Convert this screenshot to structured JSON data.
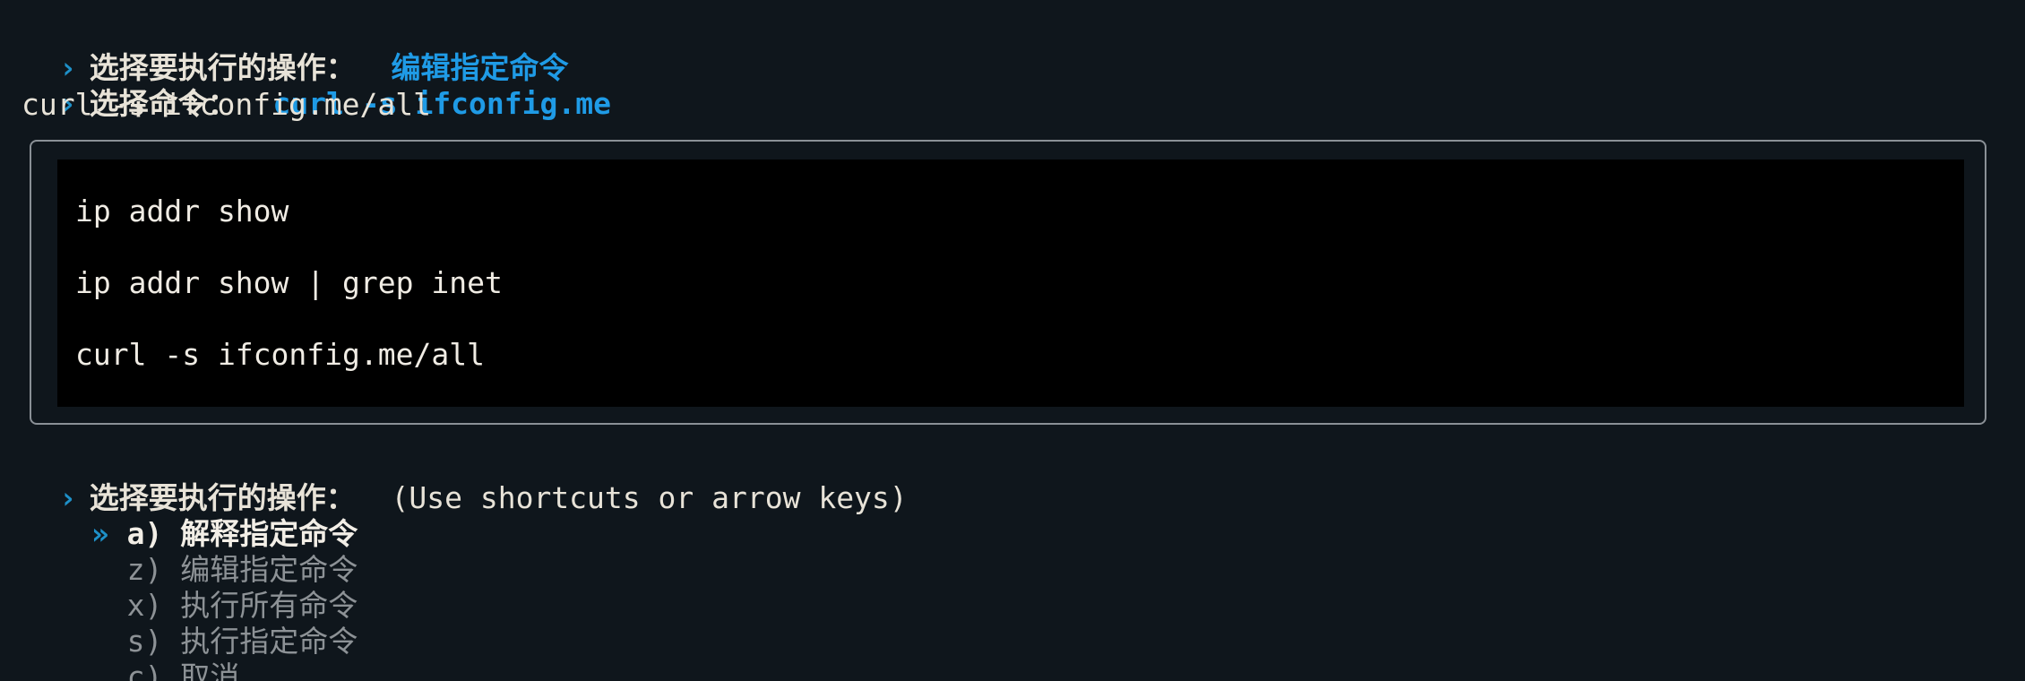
{
  "history": [
    {
      "marker": "›",
      "label": "选择要执行的操作：",
      "answer": "编辑指定命令"
    },
    {
      "marker": "›",
      "label": "选择命令：",
      "answer": "curl -s ifconfig.me"
    }
  ],
  "echo_line": "curl -s ifconfig.me/all",
  "panel": {
    "lines": [
      "ip addr show",
      "ip addr show | grep inet",
      "curl -s ifconfig.me/all"
    ]
  },
  "current_prompt": {
    "marker": "›",
    "label": "选择要执行的操作：",
    "hint": "(Use shortcuts or arrow keys)"
  },
  "menu": {
    "pointer": "»",
    "items": [
      {
        "label": "a) 解释指定命令",
        "selected": true
      },
      {
        "label": "z) 编辑指定命令",
        "selected": false
      },
      {
        "label": "x) 执行所有命令",
        "selected": false
      },
      {
        "label": "s) 执行指定命令",
        "selected": false
      },
      {
        "label": "c) 取消",
        "selected": false
      }
    ]
  },
  "colors": {
    "background": "#0f161c",
    "accent": "#1f9be6",
    "dim": "#8d9296"
  }
}
